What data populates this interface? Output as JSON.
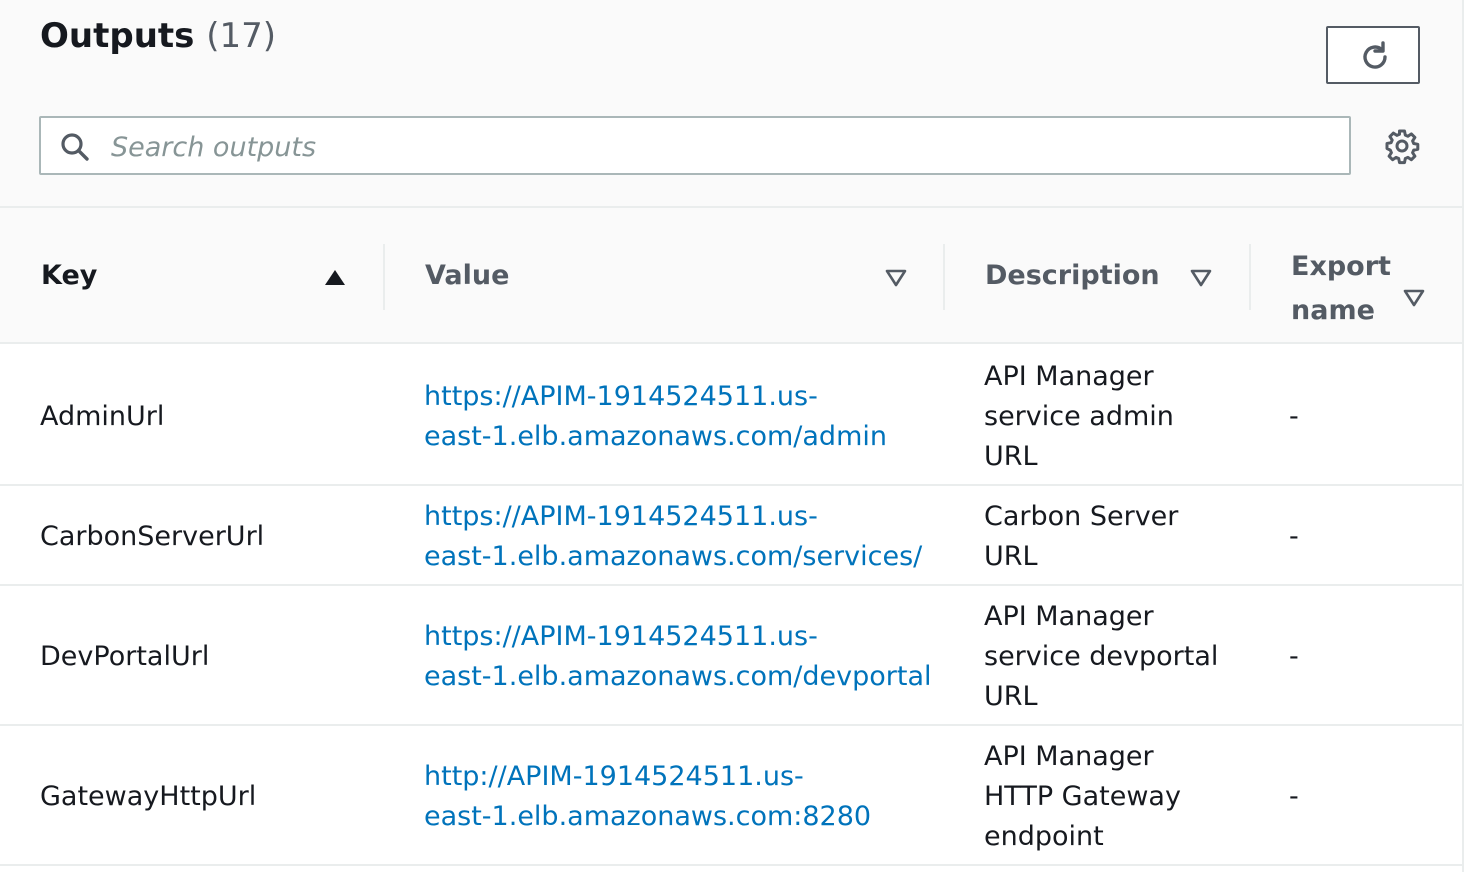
{
  "header": {
    "title": "Outputs",
    "count": "(17)",
    "refresh_icon": "refresh-icon",
    "settings_icon": "gear-icon"
  },
  "search": {
    "placeholder": "Search outputs",
    "value": "",
    "icon": "search-icon"
  },
  "table": {
    "columns": [
      {
        "label": "Key",
        "sort": "ascending",
        "sort_icon": "sort-ascending-icon"
      },
      {
        "label": "Value",
        "sort": "none",
        "sort_icon": "sort-down-icon"
      },
      {
        "label": "Description",
        "sort": "none",
        "sort_icon": "sort-down-icon"
      },
      {
        "label": "Export",
        "label_line2": "name",
        "sort": "none",
        "sort_icon": "sort-down-icon"
      }
    ],
    "rows": [
      {
        "key": "AdminUrl",
        "value_lines": [
          "https://APIM-1914524511.us-",
          "east-1.elb.amazonaws.com/admin"
        ],
        "description_lines": [
          "API Manager",
          "service admin",
          "URL"
        ],
        "export_name": "-"
      },
      {
        "key": "CarbonServerUrl",
        "value_lines": [
          "https://APIM-1914524511.us-",
          "east-1.elb.amazonaws.com/services/"
        ],
        "description_lines": [
          "Carbon Server",
          "URL"
        ],
        "export_name": "-"
      },
      {
        "key": "DevPortalUrl",
        "value_lines": [
          "https://APIM-1914524511.us-",
          "east-1.elb.amazonaws.com/devportal"
        ],
        "description_lines": [
          "API Manager",
          "service devportal",
          "URL"
        ],
        "export_name": "-"
      },
      {
        "key": "GatewayHttpUrl",
        "value_lines": [
          "http://APIM-1914524511.us-",
          "east-1.elb.amazonaws.com:8280"
        ],
        "description_lines": [
          "API Manager",
          "HTTP Gateway",
          "endpoint"
        ],
        "export_name": "-"
      }
    ]
  },
  "colors": {
    "link": "#0073bb",
    "text": "#16191f",
    "muted": "#545b64",
    "border": "#eaeded",
    "header_bg": "#fafafa"
  }
}
